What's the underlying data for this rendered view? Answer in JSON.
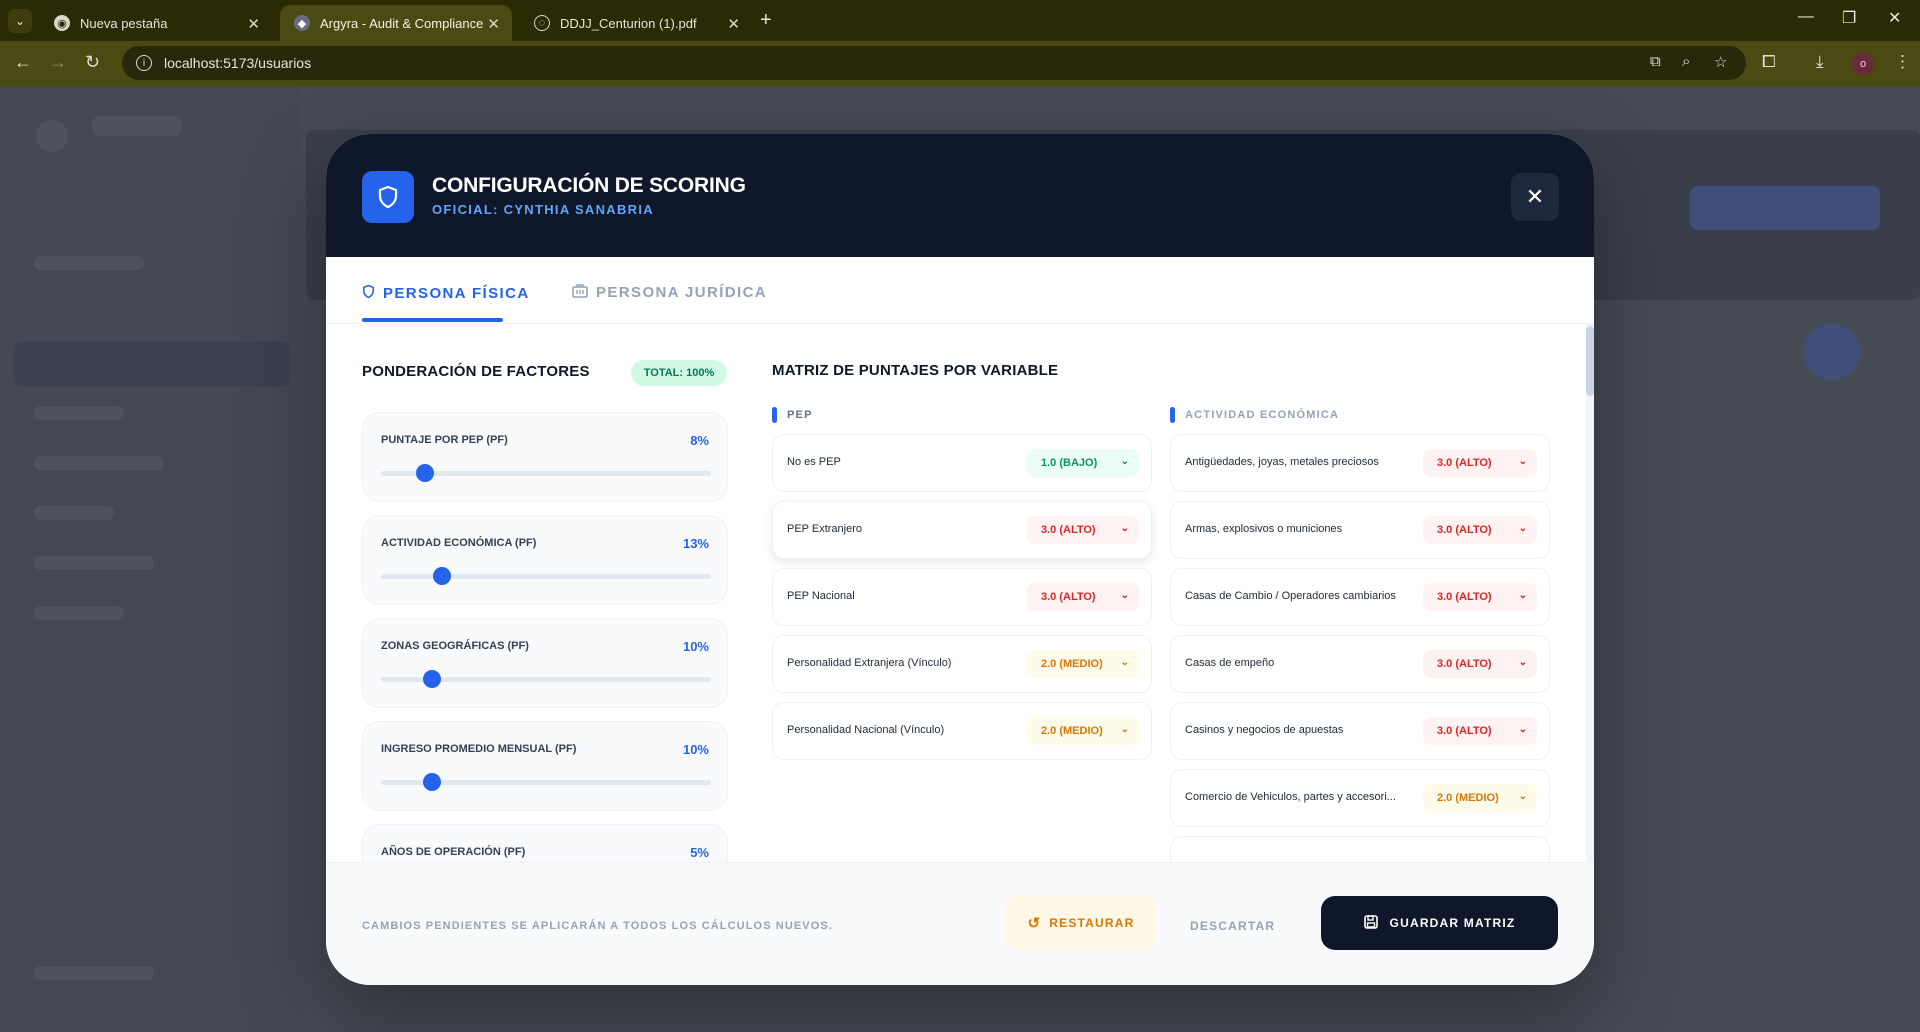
{
  "browser": {
    "tabs": [
      {
        "title": "Nueva pestaña",
        "active": false
      },
      {
        "title": "Argyra - Audit & Compliance",
        "active": true
      },
      {
        "title": "DDJJ_Centurion (1).pdf",
        "active": false
      }
    ],
    "url": "localhost:5173/usuarios",
    "profile_initial": "o"
  },
  "modal": {
    "title": "CONFIGURACIÓN DE SCORING",
    "subtitle": "OFICIAL: CYNTHIA SANABRIA",
    "tabs": {
      "fisica": "PERSONA FÍSICA",
      "juridica": "PERSONA JURÍDICA"
    },
    "weights": {
      "title": "PONDERACIÓN DE FACTORES",
      "total": "TOTAL: 100%",
      "factors": [
        {
          "label": "PUNTAJE POR PEP (PF)",
          "value": "8%",
          "level": 0.08
        },
        {
          "label": "ACTIVIDAD ECONÓMICA (PF)",
          "value": "13%",
          "level": 0.13
        },
        {
          "label": "ZONAS GEOGRÁFICAS (PF)",
          "value": "10%",
          "level": 0.1
        },
        {
          "label": "INGRESO PROMEDIO MENSUAL (PF)",
          "value": "10%",
          "level": 0.1
        },
        {
          "label": "AÑOS DE OPERACIÓN (PF)",
          "value": "5%",
          "level": 0.05
        }
      ]
    },
    "matrix": {
      "title": "MATRIZ DE PUNTAJES POR VARIABLE",
      "pep": {
        "label": "PEP",
        "rows": [
          {
            "label": "No es PEP",
            "score": "1.0 (BAJO)",
            "level": "bajo"
          },
          {
            "label": "PEP Extranjero",
            "score": "3.0 (ALTO)",
            "level": "alto"
          },
          {
            "label": "PEP Nacional",
            "score": "3.0 (ALTO)",
            "level": "alto"
          },
          {
            "label": "Personalidad Extranjera (Vínculo)",
            "score": "2.0 (MEDIO)",
            "level": "medio"
          },
          {
            "label": "Personalidad Nacional (Vínculo)",
            "score": "2.0 (MEDIO)",
            "level": "medio"
          }
        ]
      },
      "actividad": {
        "label": "ACTIVIDAD ECONÓMICA",
        "rows": [
          {
            "label": "Antigüedades, joyas, metales preciosos",
            "score": "3.0 (ALTO)",
            "level": "alto"
          },
          {
            "label": "Armas, explosivos o municiones",
            "score": "3.0 (ALTO)",
            "level": "alto"
          },
          {
            "label": "Casas de Cambio / Operadores cambiarios",
            "score": "3.0 (ALTO)",
            "level": "alto"
          },
          {
            "label": "Casas de empeño",
            "score": "3.0 (ALTO)",
            "level": "alto"
          },
          {
            "label": "Casinos y negocios de apuestas",
            "score": "3.0 (ALTO)",
            "level": "alto"
          },
          {
            "label": "Comercio de Vehiculos, partes y accesori...",
            "score": "2.0 (MEDIO)",
            "level": "medio"
          }
        ]
      }
    },
    "footer": {
      "note": "CAMBIOS PENDIENTES SE APLICARÁN A TODOS LOS CÁLCULOS NUEVOS.",
      "restore": "RESTAURAR",
      "discard": "DESCARTAR",
      "save": "GUARDAR MATRIZ"
    }
  },
  "colors": {
    "accent": "#2563eb",
    "dark": "#0f172a",
    "alto": "#dc2626",
    "medio": "#d97706",
    "bajo": "#059669"
  },
  "icons": [
    "shield-icon",
    "building-icon",
    "close-icon",
    "chevron-down-icon",
    "restore-icon",
    "save-icon"
  ]
}
